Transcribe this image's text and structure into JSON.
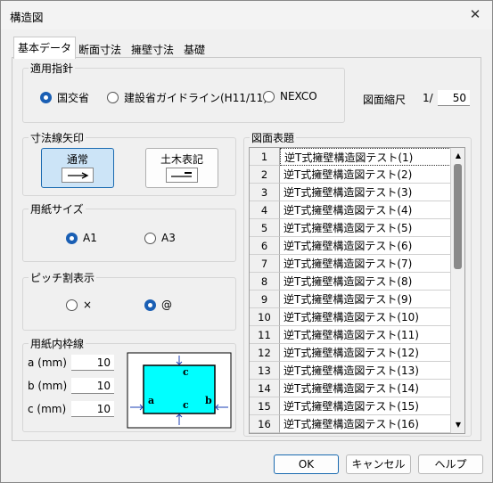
{
  "window": {
    "title": "構造図",
    "close_glyph": "✕"
  },
  "tabs": [
    {
      "label": "基本データ",
      "active": true
    },
    {
      "label": "断面寸法",
      "active": false
    },
    {
      "label": "擁壁寸法",
      "active": false
    },
    {
      "label": "基礎",
      "active": false
    }
  ],
  "guideline": {
    "legend": "適用指針",
    "options": [
      {
        "label": "国交省",
        "selected": true
      },
      {
        "label": "建設省ガイドライン(H11/11)",
        "selected": false
      },
      {
        "label": "NEXCO",
        "selected": false
      }
    ]
  },
  "scale": {
    "label": "図面縮尺",
    "prefix": "1/",
    "value": "50"
  },
  "arrow": {
    "legend": "寸法線矢印",
    "options": [
      {
        "label": "通常",
        "icon": "arrow-right-icon",
        "selected": true
      },
      {
        "label": "土木表記",
        "icon": "tick-line-icon",
        "selected": false
      }
    ]
  },
  "paper": {
    "legend": "用紙サイズ",
    "options": [
      {
        "label": "A1",
        "selected": true
      },
      {
        "label": "A3",
        "selected": false
      }
    ]
  },
  "pitch": {
    "legend": "ピッチ割表示",
    "options": [
      {
        "label": "×",
        "selected": false
      },
      {
        "label": "@",
        "selected": true
      }
    ]
  },
  "frame": {
    "legend": "用紙内枠線",
    "fields": [
      {
        "label": "a (mm)",
        "value": "10"
      },
      {
        "label": "b (mm)",
        "value": "10"
      },
      {
        "label": "c (mm)",
        "value": "10"
      }
    ],
    "diagram": {
      "a": "a",
      "b": "b",
      "c": "c",
      "fill": "#00ffff"
    }
  },
  "titles": {
    "legend": "図面表題",
    "rows": [
      {
        "num": "1",
        "text": "逆T式擁壁構造図テスト(1)"
      },
      {
        "num": "2",
        "text": "逆T式擁壁構造図テスト(2)"
      },
      {
        "num": "3",
        "text": "逆T式擁壁構造図テスト(3)"
      },
      {
        "num": "4",
        "text": "逆T式擁壁構造図テスト(4)"
      },
      {
        "num": "5",
        "text": "逆T式擁壁構造図テスト(5)"
      },
      {
        "num": "6",
        "text": "逆T式擁壁構造図テスト(6)"
      },
      {
        "num": "7",
        "text": "逆T式擁壁構造図テスト(7)"
      },
      {
        "num": "8",
        "text": "逆T式擁壁構造図テスト(8)"
      },
      {
        "num": "9",
        "text": "逆T式擁壁構造図テスト(9)"
      },
      {
        "num": "10",
        "text": "逆T式擁壁構造図テスト(10)"
      },
      {
        "num": "11",
        "text": "逆T式擁壁構造図テスト(11)"
      },
      {
        "num": "12",
        "text": "逆T式擁壁構造図テスト(12)"
      },
      {
        "num": "13",
        "text": "逆T式擁壁構造図テスト(13)"
      },
      {
        "num": "14",
        "text": "逆T式擁壁構造図テスト(14)"
      },
      {
        "num": "15",
        "text": "逆T式擁壁構造図テスト(15)"
      },
      {
        "num": "16",
        "text": "逆T式擁壁構造図テスト(16)"
      }
    ]
  },
  "buttons": {
    "ok": "OK",
    "cancel": "キャンセル",
    "help": "ヘルプ"
  },
  "colors": {
    "accent": "#1a5fb4",
    "selected_bg": "#cce4f7"
  }
}
